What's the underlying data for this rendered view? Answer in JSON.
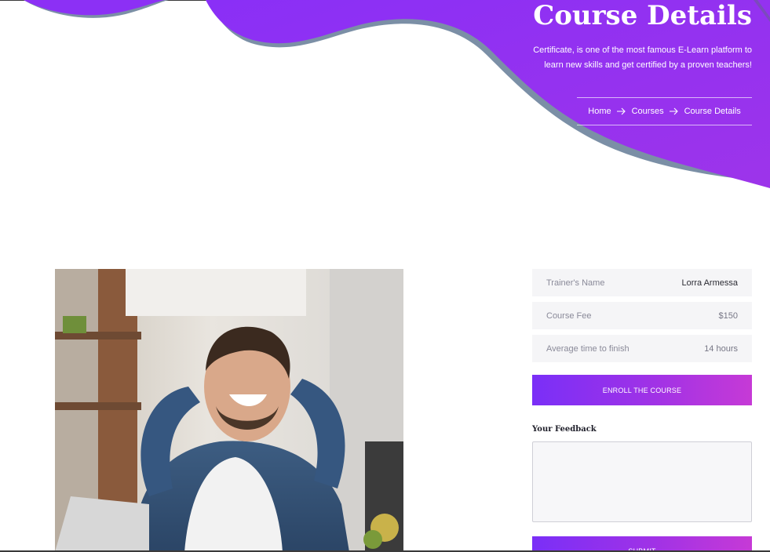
{
  "hero": {
    "title": "Course Details",
    "subtitle": "Certificate, is one of the most famous E-Learn platform to learn new skills and get certified by a proven teachers!",
    "colors": {
      "accent": "#8c30f5",
      "shadow": "#7b8fa6"
    }
  },
  "breadcrumb": {
    "items": [
      "Home",
      "Courses",
      "Course Details"
    ],
    "separator_icon": "arrow-right-icon"
  },
  "course": {
    "image_alt": "Smiling man relaxing with hands behind head in front of laptop"
  },
  "details": [
    {
      "key": "Trainer's Name",
      "value": "Lorra Armessa"
    },
    {
      "key": "Course Fee",
      "value": "$150"
    },
    {
      "key": "Average time to finish",
      "value": "14 hours"
    }
  ],
  "enroll_label": "ENROLL THE COURSE",
  "feedback": {
    "label": "Your Feedback",
    "placeholder": "",
    "submit_label": "SUBMIT"
  },
  "colors": {
    "button_gradient_start": "#7a2ff7",
    "button_gradient_end": "#c63ad6",
    "row_bg": "#f5f5f7"
  }
}
